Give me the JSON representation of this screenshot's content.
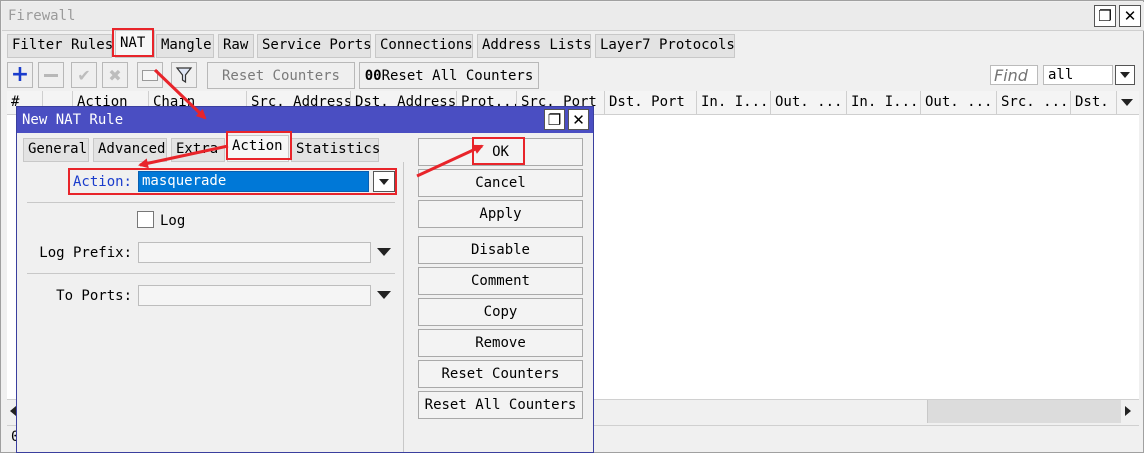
{
  "window": {
    "title": "Firewall",
    "restore_symbol": "❐",
    "close_symbol": "✕"
  },
  "main_tabs": [
    "Filter Rules",
    "NAT",
    "Mangle",
    "Raw",
    "Service Ports",
    "Connections",
    "Address Lists",
    "Layer7 Protocols"
  ],
  "toolbar": {
    "reset_counters": "Reset Counters",
    "reset_all_prefix": "00",
    "reset_all_counters": "Reset All Counters",
    "find_placeholder": "Find",
    "filter_value": "all"
  },
  "columns": [
    "#",
    "",
    "Action",
    "Chain",
    "Src. Address",
    "Dst. Address",
    "Prot...",
    "Src. Port",
    "Dst. Port",
    "In. I...",
    "Out. ...",
    "In. I...",
    "Out. ...",
    "Src. ...",
    "Dst."
  ],
  "status_bar": "0",
  "dialog": {
    "title": "New NAT Rule",
    "tabs": [
      "General",
      "Advanced",
      "Extra",
      "Action",
      "Statistics"
    ],
    "action_label": "Action:",
    "action_value": "masquerade",
    "log_label": "Log",
    "log_checked": false,
    "log_prefix_label": "Log Prefix:",
    "log_prefix_value": "",
    "to_ports_label": "To Ports:",
    "to_ports_value": "",
    "buttons": [
      "OK",
      "Cancel",
      "Apply",
      "Disable",
      "Comment",
      "Copy",
      "Remove",
      "Reset Counters",
      "Reset All Counters"
    ]
  },
  "colors": {
    "annotation_red": "#e8242a",
    "dialog_title_bg": "#4a4ec2",
    "selection_blue": "#0078d7",
    "add_icon_blue": "#1a3ccc"
  },
  "icons": [
    "add-icon",
    "remove-icon",
    "enable-icon",
    "disable-icon",
    "comment-icon",
    "filter-icon",
    "dropdown-icon",
    "scroll-left-icon",
    "scroll-right-icon",
    "restore-icon",
    "close-icon"
  ]
}
